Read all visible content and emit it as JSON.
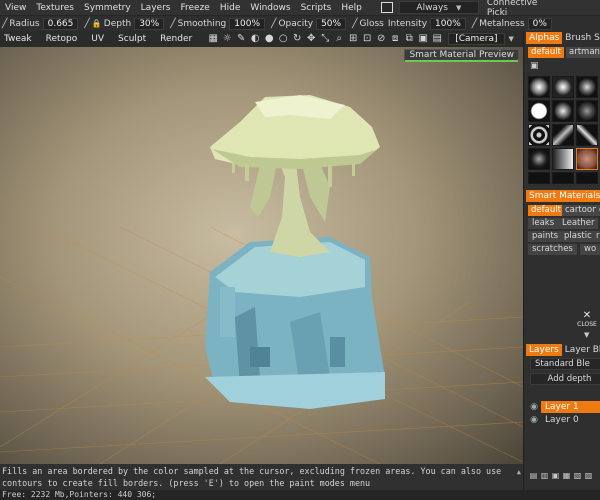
{
  "menu": {
    "items": [
      "View",
      "Textures",
      "Symmetry",
      "Layers",
      "Freeze",
      "Hide",
      "Windows",
      "Scripts",
      "Help"
    ],
    "mode_dropdown": "Always",
    "pick_dropdown": "Connective Picki"
  },
  "params": {
    "radius_label": "Radius",
    "radius_value": "0.665",
    "depth_label": "Depth",
    "depth_value": "30%",
    "smoothing_label": "Smoothing",
    "smoothing_value": "100%",
    "opacity_label": "Opacity",
    "opacity_value": "50%",
    "gloss_label": "Gloss",
    "intensity_label": "Intensity",
    "intensity_value": "100%",
    "metalness_label": "Metalness",
    "metalness_value": "0%"
  },
  "rooms": [
    "Tweak",
    "Retopo",
    "UV",
    "Sculpt",
    "Render"
  ],
  "camera_dropdown": "[Camera]",
  "viewport": {
    "smart_material_preview": "Smart Material Preview"
  },
  "alphas": {
    "tabs": [
      "Alphas",
      "Brush Stu"
    ],
    "subtabs": [
      "default",
      "artman"
    ]
  },
  "smart_materials": {
    "title": "Smart Materials",
    "subtabs": [
      "default",
      "cartoon",
      "c"
    ],
    "chips": [
      [
        "leaks",
        "Leather"
      ],
      [
        "paints",
        "plastic",
        "ru"
      ],
      [
        "scratches",
        "wo"
      ]
    ]
  },
  "close_label": "CLOSE",
  "layers": {
    "tabs": [
      "Layers",
      "Layer Ble"
    ],
    "blend_mode": "Standard Ble",
    "add_depth": "Add depth",
    "items": [
      "Layer 1",
      "Layer 0"
    ]
  },
  "status": {
    "hint": "Fills an area bordered by the color sampled at the cursor, excluding frozen areas. You can also use contours to create fill borders. (press 'E') to open the paint modes menu",
    "free": "Free: 2232 Mb,Pointers: 440 306;"
  },
  "colors": {
    "accent": "#f07a12",
    "preview_underline": "#6acb50",
    "canopy": "#dfe6b4",
    "base": "#8ec5cf"
  }
}
